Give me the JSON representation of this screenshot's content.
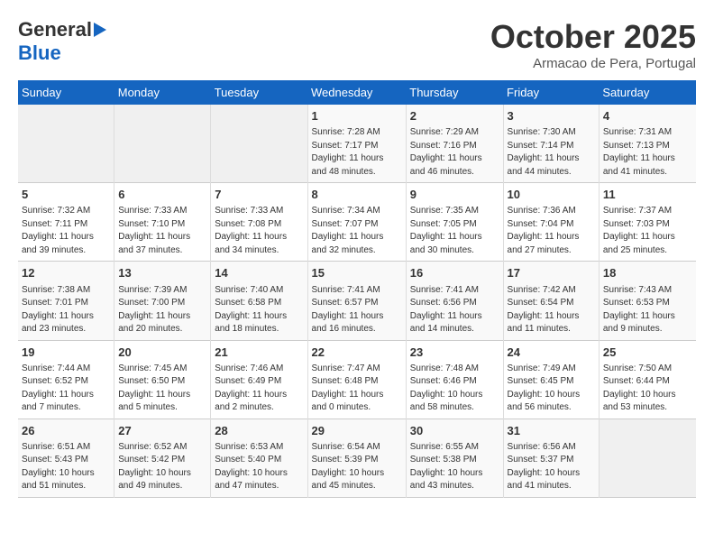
{
  "header": {
    "logo_line1": "General",
    "logo_line2": "Blue",
    "month": "October 2025",
    "location": "Armacao de Pera, Portugal"
  },
  "days_of_week": [
    "Sunday",
    "Monday",
    "Tuesday",
    "Wednesday",
    "Thursday",
    "Friday",
    "Saturday"
  ],
  "weeks": [
    [
      {
        "day": "",
        "info": ""
      },
      {
        "day": "",
        "info": ""
      },
      {
        "day": "",
        "info": ""
      },
      {
        "day": "1",
        "info": "Sunrise: 7:28 AM\nSunset: 7:17 PM\nDaylight: 11 hours\nand 48 minutes."
      },
      {
        "day": "2",
        "info": "Sunrise: 7:29 AM\nSunset: 7:16 PM\nDaylight: 11 hours\nand 46 minutes."
      },
      {
        "day": "3",
        "info": "Sunrise: 7:30 AM\nSunset: 7:14 PM\nDaylight: 11 hours\nand 44 minutes."
      },
      {
        "day": "4",
        "info": "Sunrise: 7:31 AM\nSunset: 7:13 PM\nDaylight: 11 hours\nand 41 minutes."
      }
    ],
    [
      {
        "day": "5",
        "info": "Sunrise: 7:32 AM\nSunset: 7:11 PM\nDaylight: 11 hours\nand 39 minutes."
      },
      {
        "day": "6",
        "info": "Sunrise: 7:33 AM\nSunset: 7:10 PM\nDaylight: 11 hours\nand 37 minutes."
      },
      {
        "day": "7",
        "info": "Sunrise: 7:33 AM\nSunset: 7:08 PM\nDaylight: 11 hours\nand 34 minutes."
      },
      {
        "day": "8",
        "info": "Sunrise: 7:34 AM\nSunset: 7:07 PM\nDaylight: 11 hours\nand 32 minutes."
      },
      {
        "day": "9",
        "info": "Sunrise: 7:35 AM\nSunset: 7:05 PM\nDaylight: 11 hours\nand 30 minutes."
      },
      {
        "day": "10",
        "info": "Sunrise: 7:36 AM\nSunset: 7:04 PM\nDaylight: 11 hours\nand 27 minutes."
      },
      {
        "day": "11",
        "info": "Sunrise: 7:37 AM\nSunset: 7:03 PM\nDaylight: 11 hours\nand 25 minutes."
      }
    ],
    [
      {
        "day": "12",
        "info": "Sunrise: 7:38 AM\nSunset: 7:01 PM\nDaylight: 11 hours\nand 23 minutes."
      },
      {
        "day": "13",
        "info": "Sunrise: 7:39 AM\nSunset: 7:00 PM\nDaylight: 11 hours\nand 20 minutes."
      },
      {
        "day": "14",
        "info": "Sunrise: 7:40 AM\nSunset: 6:58 PM\nDaylight: 11 hours\nand 18 minutes."
      },
      {
        "day": "15",
        "info": "Sunrise: 7:41 AM\nSunset: 6:57 PM\nDaylight: 11 hours\nand 16 minutes."
      },
      {
        "day": "16",
        "info": "Sunrise: 7:41 AM\nSunset: 6:56 PM\nDaylight: 11 hours\nand 14 minutes."
      },
      {
        "day": "17",
        "info": "Sunrise: 7:42 AM\nSunset: 6:54 PM\nDaylight: 11 hours\nand 11 minutes."
      },
      {
        "day": "18",
        "info": "Sunrise: 7:43 AM\nSunset: 6:53 PM\nDaylight: 11 hours\nand 9 minutes."
      }
    ],
    [
      {
        "day": "19",
        "info": "Sunrise: 7:44 AM\nSunset: 6:52 PM\nDaylight: 11 hours\nand 7 minutes."
      },
      {
        "day": "20",
        "info": "Sunrise: 7:45 AM\nSunset: 6:50 PM\nDaylight: 11 hours\nand 5 minutes."
      },
      {
        "day": "21",
        "info": "Sunrise: 7:46 AM\nSunset: 6:49 PM\nDaylight: 11 hours\nand 2 minutes."
      },
      {
        "day": "22",
        "info": "Sunrise: 7:47 AM\nSunset: 6:48 PM\nDaylight: 11 hours\nand 0 minutes."
      },
      {
        "day": "23",
        "info": "Sunrise: 7:48 AM\nSunset: 6:46 PM\nDaylight: 10 hours\nand 58 minutes."
      },
      {
        "day": "24",
        "info": "Sunrise: 7:49 AM\nSunset: 6:45 PM\nDaylight: 10 hours\nand 56 minutes."
      },
      {
        "day": "25",
        "info": "Sunrise: 7:50 AM\nSunset: 6:44 PM\nDaylight: 10 hours\nand 53 minutes."
      }
    ],
    [
      {
        "day": "26",
        "info": "Sunrise: 6:51 AM\nSunset: 5:43 PM\nDaylight: 10 hours\nand 51 minutes."
      },
      {
        "day": "27",
        "info": "Sunrise: 6:52 AM\nSunset: 5:42 PM\nDaylight: 10 hours\nand 49 minutes."
      },
      {
        "day": "28",
        "info": "Sunrise: 6:53 AM\nSunset: 5:40 PM\nDaylight: 10 hours\nand 47 minutes."
      },
      {
        "day": "29",
        "info": "Sunrise: 6:54 AM\nSunset: 5:39 PM\nDaylight: 10 hours\nand 45 minutes."
      },
      {
        "day": "30",
        "info": "Sunrise: 6:55 AM\nSunset: 5:38 PM\nDaylight: 10 hours\nand 43 minutes."
      },
      {
        "day": "31",
        "info": "Sunrise: 6:56 AM\nSunset: 5:37 PM\nDaylight: 10 hours\nand 41 minutes."
      },
      {
        "day": "",
        "info": ""
      }
    ]
  ]
}
